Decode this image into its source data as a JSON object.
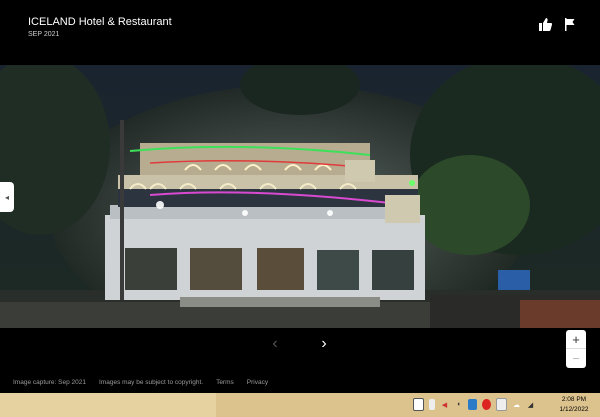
{
  "header": {
    "title": "ICELAND Hotel & Restaurant",
    "date": "SEP 2021"
  },
  "photo": {
    "hotel_sign_text": ""
  },
  "navigation": {
    "prev_glyph": "‹",
    "next_glyph": "›",
    "side_glyph": "◂"
  },
  "zoom": {
    "in_label": "+",
    "out_label": "−"
  },
  "footer": {
    "capture": "Image capture: Sep 2021",
    "copyright": "Images may be subject to copyright.",
    "terms": "Terms",
    "privacy": "Privacy"
  },
  "taskbar": {
    "time": "2:08 PM",
    "date": "1/12/2022",
    "tray_icons": [
      "network-icon",
      "battery-icon",
      "volume-icon",
      "speaker-icon",
      "app-icon",
      "shield-icon",
      "security-icon",
      "cloud-icon",
      "wifi-icon"
    ]
  },
  "colors": {
    "taskbar": "#dcc28c",
    "background": "#000000"
  }
}
